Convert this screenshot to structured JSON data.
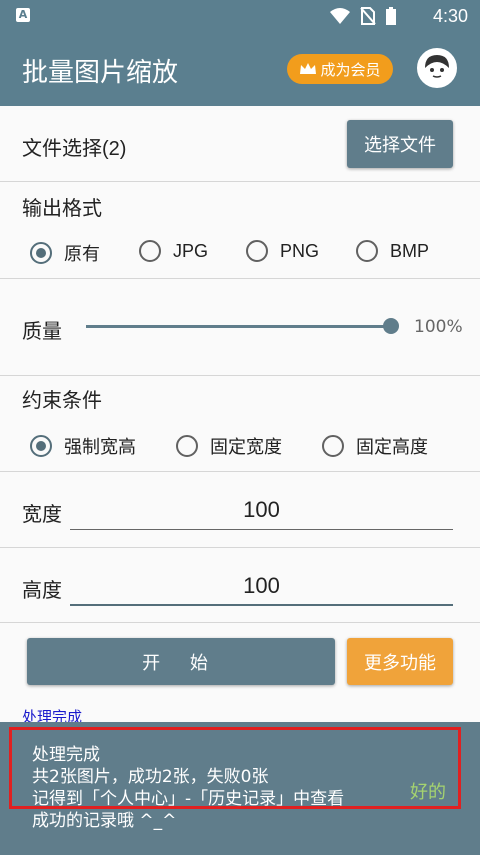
{
  "status_bar": {
    "sim_indicator": "A",
    "time": "4:30"
  },
  "app_bar": {
    "title": "批量图片缩放",
    "vip_button": "成为会员"
  },
  "file_select": {
    "label": "文件选择(2)",
    "button": "选择文件"
  },
  "output_format": {
    "label": "输出格式",
    "options": [
      "原有",
      "JPG",
      "PNG",
      "BMP"
    ],
    "selected": "原有"
  },
  "quality": {
    "label": "质量",
    "value_text": "100%",
    "value": 1.0
  },
  "constraint": {
    "label": "约束条件",
    "options": [
      "强制宽高",
      "固定宽度",
      "固定高度"
    ],
    "selected": "强制宽高"
  },
  "width": {
    "label": "宽度",
    "value": "100"
  },
  "height": {
    "label": "高度",
    "value": "100"
  },
  "actions": {
    "start": "开 始",
    "more": "更多功能"
  },
  "status_text": "处理完成",
  "snackbar": {
    "message": "处理完成\n共2张图片，成功2张，失败0张\n记得到「个人中心」-「历史记录」中查看\n成功的记录哦 ^_^",
    "action": "好的"
  },
  "colors": {
    "primary": "#607d8b",
    "accent": "#f29d1c",
    "highlight": "#e02020"
  }
}
